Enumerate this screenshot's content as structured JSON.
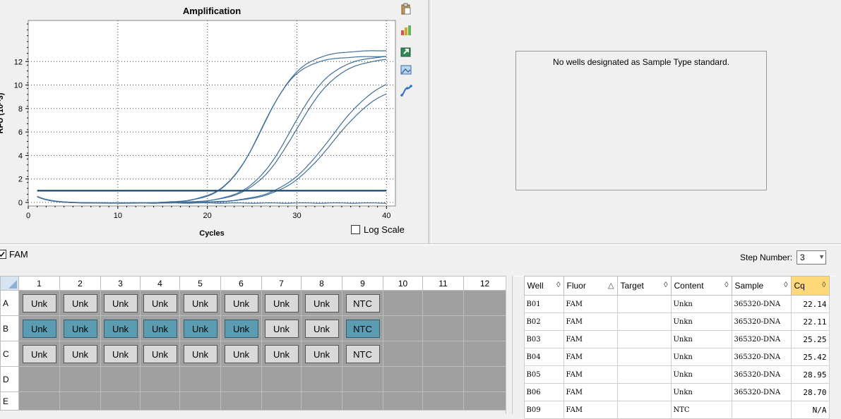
{
  "chart_data": {
    "type": "line",
    "title": "Amplification",
    "xlabel": "Cycles",
    "ylabel": "RFU (10^3)",
    "xlim": [
      0,
      41
    ],
    "ylim": [
      -0.3,
      15.5
    ],
    "xticks": [
      0,
      10,
      20,
      30,
      40
    ],
    "yticks": [
      0,
      2,
      4,
      6,
      8,
      10,
      12
    ],
    "grid": true,
    "threshold": 1,
    "series_color": "#3f6f9c",
    "series": [
      {
        "well": "B01",
        "cq": 22.14,
        "plateau": 13.0,
        "mid": 26.2,
        "slope": 2.1
      },
      {
        "well": "B02",
        "cq": 22.11,
        "plateau": 12.5,
        "mid": 26.0,
        "slope": 2.0
      },
      {
        "well": "B03",
        "cq": 25.25,
        "plateau": 12.6,
        "mid": 29.4,
        "slope": 2.3
      },
      {
        "well": "B04",
        "cq": 25.42,
        "plateau": 12.4,
        "mid": 29.9,
        "slope": 2.4
      },
      {
        "well": "B05",
        "cq": 28.95,
        "plateau": 11.2,
        "mid": 33.8,
        "slope": 2.8
      },
      {
        "well": "B06",
        "cq": 28.7,
        "plateau": 10.4,
        "mid": 34.0,
        "slope": 2.8
      },
      {
        "well": "B09",
        "cq": null,
        "plateau": 0,
        "mid": 50,
        "slope": 3
      }
    ]
  },
  "toolbar": {
    "icons": [
      "clipboard-icon",
      "chart-options-icon",
      "export-icon",
      "image-icon",
      "curve-icon"
    ]
  },
  "log_scale_label": "Log Scale",
  "standard_message": "No wells designated as Sample Type standard.",
  "fluor_filter": {
    "label": "FAM",
    "checked": true
  },
  "step_number": {
    "label": "Step Number:",
    "value": "3"
  },
  "plate": {
    "columns": [
      "1",
      "2",
      "3",
      "4",
      "5",
      "6",
      "7",
      "8",
      "9",
      "10",
      "11",
      "12"
    ],
    "rows": [
      {
        "label": "A",
        "wells": [
          "Unk",
          "Unk",
          "Unk",
          "Unk",
          "Unk",
          "Unk",
          "Unk",
          "Unk",
          "NTC"
        ],
        "selected": []
      },
      {
        "label": "B",
        "wells": [
          "Unk",
          "Unk",
          "Unk",
          "Unk",
          "Unk",
          "Unk",
          "Unk",
          "Unk",
          "NTC"
        ],
        "selected": [
          0,
          1,
          2,
          3,
          4,
          5,
          8
        ]
      },
      {
        "label": "C",
        "wells": [
          "Unk",
          "Unk",
          "Unk",
          "Unk",
          "Unk",
          "Unk",
          "Unk",
          "Unk",
          "NTC"
        ],
        "selected": []
      },
      {
        "label": "D",
        "wells": [],
        "selected": []
      },
      {
        "label": "E",
        "wells": [],
        "selected": []
      }
    ]
  },
  "results": {
    "columns": [
      {
        "label": "Well",
        "sort": "◊"
      },
      {
        "label": "Fluor",
        "sort": "△"
      },
      {
        "label": "Target",
        "sort": "◊"
      },
      {
        "label": "Content",
        "sort": "◊"
      },
      {
        "label": "Sample",
        "sort": "◊"
      },
      {
        "label": "Cq",
        "sort": "◊"
      }
    ],
    "rows": [
      [
        "B01",
        "FAM",
        "",
        "Unkn",
        "365320-DNA",
        "22.14"
      ],
      [
        "B02",
        "FAM",
        "",
        "Unkn",
        "365320-DNA",
        "22.11"
      ],
      [
        "B03",
        "FAM",
        "",
        "Unkn",
        "365320-DNA",
        "25.25"
      ],
      [
        "B04",
        "FAM",
        "",
        "Unkn",
        "365320-DNA",
        "25.42"
      ],
      [
        "B05",
        "FAM",
        "",
        "Unkn",
        "365320-DNA",
        "28.95"
      ],
      [
        "B06",
        "FAM",
        "",
        "Unkn",
        "365320-DNA",
        "28.70"
      ],
      [
        "B09",
        "FAM",
        "",
        "NTC",
        "",
        "N/A"
      ]
    ]
  }
}
